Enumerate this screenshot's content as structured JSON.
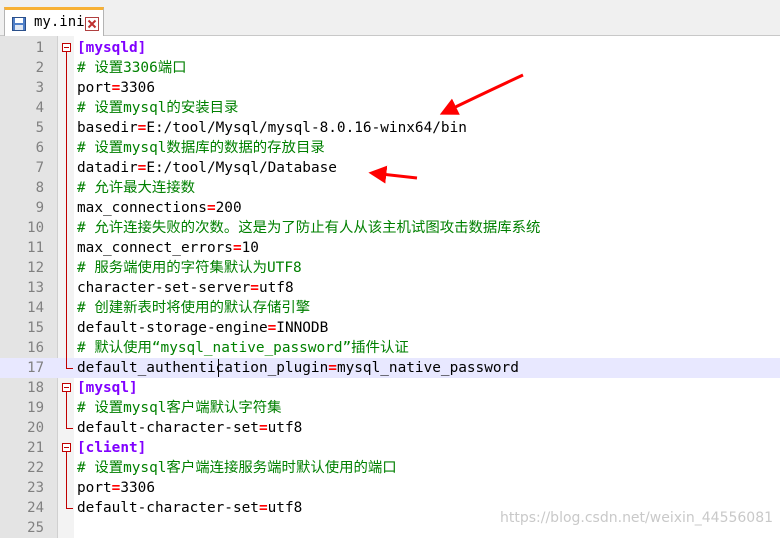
{
  "tab": {
    "title": "my.ini",
    "save_icon": "save-icon",
    "close_icon": "close-icon"
  },
  "editor": {
    "current_line": 17,
    "lines": [
      {
        "num": "1",
        "segments": [
          {
            "t": "[mysqld]",
            "c": "section"
          }
        ]
      },
      {
        "num": "2",
        "segments": [
          {
            "t": "# 设置3306端口",
            "c": "comment"
          }
        ]
      },
      {
        "num": "3",
        "segments": [
          {
            "t": "port",
            "c": "plain"
          },
          {
            "t": "=",
            "c": "eq"
          },
          {
            "t": "3306",
            "c": "plain"
          }
        ]
      },
      {
        "num": "4",
        "segments": [
          {
            "t": "# 设置mysql的安装目录",
            "c": "comment"
          }
        ]
      },
      {
        "num": "5",
        "segments": [
          {
            "t": "basedir",
            "c": "plain"
          },
          {
            "t": "=",
            "c": "eq"
          },
          {
            "t": "E:/tool/Mysql/mysql-8.0.16-winx64/bin",
            "c": "plain"
          }
        ]
      },
      {
        "num": "6",
        "segments": [
          {
            "t": "# 设置mysql数据库的数据的存放目录",
            "c": "comment"
          }
        ]
      },
      {
        "num": "7",
        "segments": [
          {
            "t": "datadir",
            "c": "plain"
          },
          {
            "t": "=",
            "c": "eq"
          },
          {
            "t": "E:/tool/Mysql/Database",
            "c": "plain"
          }
        ]
      },
      {
        "num": "8",
        "segments": [
          {
            "t": "# 允许最大连接数",
            "c": "comment"
          }
        ]
      },
      {
        "num": "9",
        "segments": [
          {
            "t": "max_connections",
            "c": "plain"
          },
          {
            "t": "=",
            "c": "eq"
          },
          {
            "t": "200",
            "c": "plain"
          }
        ]
      },
      {
        "num": "10",
        "segments": [
          {
            "t": "# 允许连接失败的次数。这是为了防止有人从该主机试图攻击数据库系统",
            "c": "comment"
          }
        ]
      },
      {
        "num": "11",
        "segments": [
          {
            "t": "max_connect_errors",
            "c": "plain"
          },
          {
            "t": "=",
            "c": "eq"
          },
          {
            "t": "10",
            "c": "plain"
          }
        ]
      },
      {
        "num": "12",
        "segments": [
          {
            "t": "# 服务端使用的字符集默认为UTF8",
            "c": "comment"
          }
        ]
      },
      {
        "num": "13",
        "segments": [
          {
            "t": "character-set-server",
            "c": "plain"
          },
          {
            "t": "=",
            "c": "eq"
          },
          {
            "t": "utf8",
            "c": "plain"
          }
        ]
      },
      {
        "num": "14",
        "segments": [
          {
            "t": "# 创建新表时将使用的默认存储引擎",
            "c": "comment"
          }
        ]
      },
      {
        "num": "15",
        "segments": [
          {
            "t": "default-storage-engine",
            "c": "plain"
          },
          {
            "t": "=",
            "c": "eq"
          },
          {
            "t": "INNODB",
            "c": "plain"
          }
        ]
      },
      {
        "num": "16",
        "segments": [
          {
            "t": "# 默认使用“mysql_native_password”插件认证",
            "c": "comment"
          }
        ]
      },
      {
        "num": "17",
        "segments": [
          {
            "t": "default_authentication_plugin",
            "c": "plain"
          },
          {
            "t": "=",
            "c": "eq"
          },
          {
            "t": "mysql_native_password",
            "c": "plain"
          }
        ]
      },
      {
        "num": "18",
        "segments": [
          {
            "t": "[mysql]",
            "c": "section"
          }
        ]
      },
      {
        "num": "19",
        "segments": [
          {
            "t": "# 设置mysql客户端默认字符集",
            "c": "comment"
          }
        ]
      },
      {
        "num": "20",
        "segments": [
          {
            "t": "default-character-set",
            "c": "plain"
          },
          {
            "t": "=",
            "c": "eq"
          },
          {
            "t": "utf8",
            "c": "plain"
          }
        ]
      },
      {
        "num": "21",
        "segments": [
          {
            "t": "[client]",
            "c": "section"
          }
        ]
      },
      {
        "num": "22",
        "segments": [
          {
            "t": "# 设置mysql客户端连接服务端时默认使用的端口",
            "c": "comment"
          }
        ]
      },
      {
        "num": "23",
        "segments": [
          {
            "t": "port",
            "c": "plain"
          },
          {
            "t": "=",
            "c": "eq"
          },
          {
            "t": "3306",
            "c": "plain"
          }
        ]
      },
      {
        "num": "24",
        "segments": [
          {
            "t": "default-character-set",
            "c": "plain"
          },
          {
            "t": "=",
            "c": "eq"
          },
          {
            "t": "utf8",
            "c": "plain"
          }
        ]
      },
      {
        "num": "25",
        "segments": []
      }
    ]
  },
  "watermark": "https://blog.csdn.net/weixin_44556081",
  "colors": {
    "comment": "#008000",
    "section": "#8000ff",
    "operator": "#ff0000",
    "annotation_arrow": "#ff0000",
    "tab_accent": "#f7b034"
  }
}
